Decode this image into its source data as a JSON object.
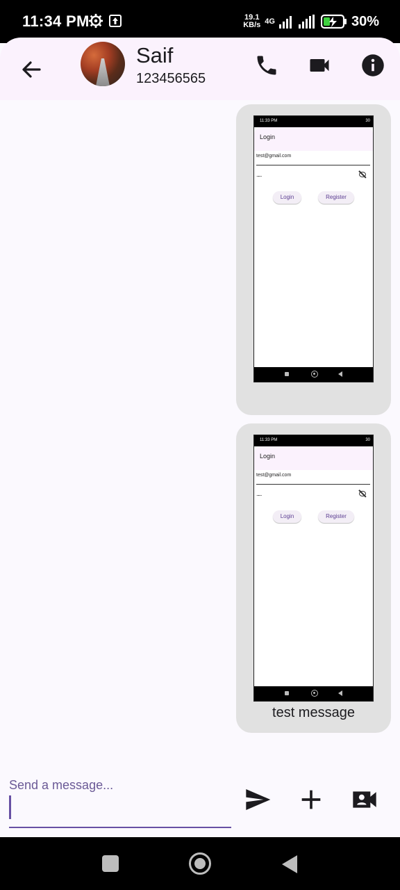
{
  "status_bar": {
    "time": "11:34 PM",
    "net_speed_value": "19.1",
    "net_speed_unit": "KB/s",
    "network_type": "4G",
    "battery": "30%"
  },
  "header": {
    "contact_name": "Saif",
    "contact_phone": "123456565"
  },
  "messages": [
    {
      "type": "image",
      "screenshot": {
        "time": "11:33 PM",
        "battery": "30",
        "title": "Login",
        "email": "test@gmail.com",
        "password_mask": "......",
        "login_label": "Login",
        "register_label": "Register"
      }
    },
    {
      "type": "image",
      "screenshot": {
        "time": "11:33 PM",
        "battery": "30",
        "title": "Login",
        "email": "test@gmail.com",
        "password_mask": "......",
        "login_label": "Login",
        "register_label": "Register"
      },
      "caption": "test message"
    }
  ],
  "composer": {
    "placeholder": "Send a message..."
  },
  "icons": {
    "back": "arrow-back-icon",
    "call": "phone-icon",
    "video": "videocam-icon",
    "info": "info-icon",
    "send": "send-icon",
    "attach": "add-icon",
    "video_message": "video-contact-icon"
  },
  "colors": {
    "accent": "#6750a4",
    "bubble": "#e1e1e1",
    "appbar": "#fbf2fd"
  }
}
